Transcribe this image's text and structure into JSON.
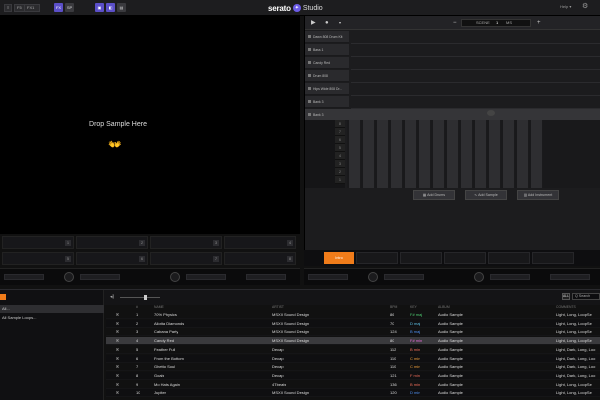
{
  "topbar": {
    "deck_value": "F5",
    "mode_value": "FX1",
    "btn_a": "FX",
    "btn_b": "SP",
    "btn_c": "",
    "btn_d": "",
    "brand_logo": "serato",
    "brand_name": "Studio",
    "help_label": "Help ▾",
    "gear_icon": "⚙"
  },
  "drop_area": {
    "text": "Drop Sample Here",
    "hands_icon": "👐"
  },
  "pads": {
    "row1": [
      "1",
      "2",
      "3",
      "4"
    ],
    "row2": [
      "5",
      "6",
      "7",
      "8"
    ]
  },
  "studio": {
    "play_icon": "▶",
    "record_icon": "●",
    "minus_icon": "−",
    "plus_icon": "+",
    "scene_label": "SCENE",
    "scene_number": "1",
    "scene_unit": "MS",
    "tracks": [
      "Dawn 808 Drum Kit",
      "Bass 1",
      "Candy Red",
      "Drum 808",
      "Hips Wide 808 Dr...",
      "Bank 3",
      "Bank 3"
    ],
    "piano_labels": [
      "8",
      "7",
      "6",
      "5",
      "4",
      "3",
      "2",
      "1"
    ],
    "buttons": {
      "add_drums": "Add Drums",
      "add_sample": "Add Sample",
      "add_instrument": "Add Instrument"
    },
    "scene_active": "Intro"
  },
  "library": {
    "items": [
      "All...",
      "All Sample Loops..."
    ],
    "all_label": "ALL",
    "search_placeholder": "Q Search",
    "columns": [
      "#",
      "NAME",
      "ARTIST",
      "BPM",
      "KEY",
      "ALBUM",
      "COMMENTS"
    ],
    "rows": [
      {
        "n": "1",
        "name": "70% Physics",
        "artist": "MSXII Sound Design",
        "bpm": "86",
        "key": "F# maj",
        "key_color": "#4ecb71",
        "album": "Audio Sample",
        "comments": "Light, Long, LoopSe"
      },
      {
        "n": "2",
        "name": "Aliotta Diamonds",
        "artist": "MSXII Sound Design",
        "bpm": "70",
        "key": "D maj",
        "key_color": "#5ec1e6",
        "album": "Audio Sample",
        "comments": "Light, Long, LoopSe"
      },
      {
        "n": "3",
        "name": "Cabana Party",
        "artist": "MSXII Sound Design",
        "bpm": "124",
        "key": "B maj",
        "key_color": "#4e8ff0",
        "album": "Audio Sample",
        "comments": "Light, Long, LoopSe"
      },
      {
        "n": "4",
        "name": "Candy Red",
        "artist": "MSXII Sound Design",
        "bpm": "80",
        "key": "F# min",
        "key_color": "#e56ad8",
        "album": "Audio Sample",
        "comments": "Light, Long, LoopSe"
      },
      {
        "n": "5",
        "name": "Feather Full",
        "artist": "Decap",
        "bpm": "112",
        "key": "B min",
        "key_color": "#ef6d5a",
        "album": "Audio Sample",
        "comments": "Light, Dark, Long, Loo"
      },
      {
        "n": "6",
        "name": "From the Bottom",
        "artist": "Decap",
        "bpm": "110",
        "key": "C min",
        "key_color": "#f0a03c",
        "album": "Audio Sample",
        "comments": "Light, Dark, Long, Loo"
      },
      {
        "n": "7",
        "name": "Ghetto Soul",
        "artist": "Decap",
        "bpm": "110",
        "key": "C min",
        "key_color": "#f0a03c",
        "album": "Audio Sample",
        "comments": "Light, Dark, Long, Loo"
      },
      {
        "n": "8",
        "name": "Goals",
        "artist": "Decap",
        "bpm": "121",
        "key": "F min",
        "key_color": "#ef6d5a",
        "album": "Audio Sample",
        "comments": "Light, Dark, Long, Loo"
      },
      {
        "n": "9",
        "name": "Mo Hats Again",
        "artist": "4Tbeats",
        "bpm": "136",
        "key": "B min",
        "key_color": "#ef6d5a",
        "album": "Audio Sample",
        "comments": "Light, Long, LoopSe"
      },
      {
        "n": "10",
        "name": "Jupiter",
        "artist": "MSXII Sound Design",
        "bpm": "120",
        "key": "D min",
        "key_color": "#4e8ff0",
        "album": "Audio Sample",
        "comments": "Light, Long, LoopSe"
      }
    ]
  },
  "colors": {
    "accent_orange": "#f07c1a",
    "brand_purple": "#6c5ce7"
  }
}
